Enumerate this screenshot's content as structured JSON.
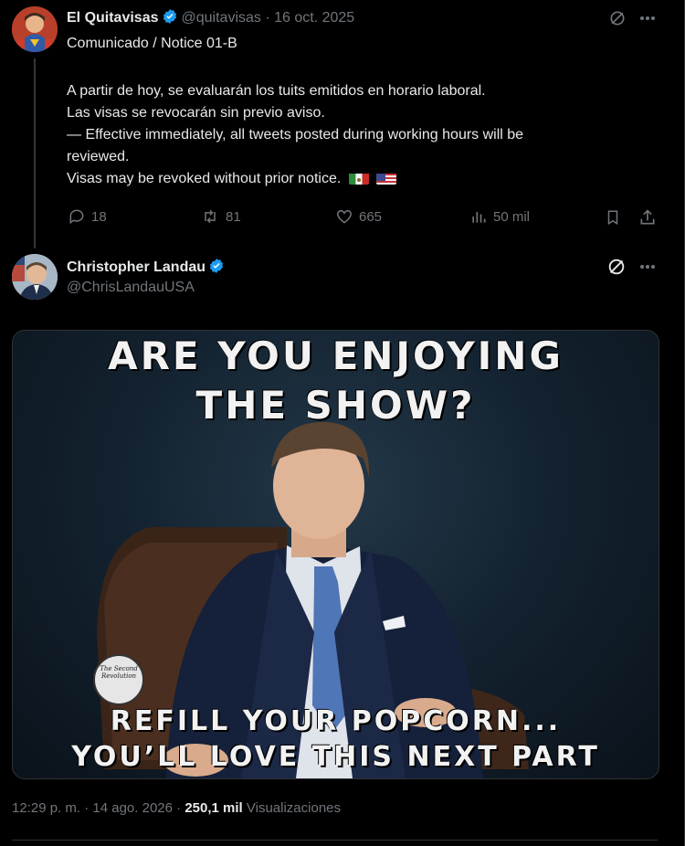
{
  "colors": {
    "background": "#000000",
    "text": "#e7e9ea",
    "muted": "#71767b",
    "verified": "#1d9bf0",
    "border": "#2f3336"
  },
  "parent_tweet": {
    "author_name": "El Quitavisas",
    "handle": "@quitavisas",
    "separator": "·",
    "date": "16 oct. 2025",
    "lines": [
      "Comunicado / Notice 01-B",
      "A partir de hoy, se evaluarán los tuits emitidos en horario laboral.",
      "Las visas se revocarán sin previo aviso.",
      "— Effective immediately, all tweets posted during working hours will be",
      "reviewed.",
      "Visas may be revoked without prior notice."
    ],
    "flags": [
      "mexico-flag",
      "usa-flag"
    ],
    "replies": "18",
    "reposts": "81",
    "likes": "665",
    "views": "50 mil",
    "icons": [
      "reply-icon",
      "repost-icon",
      "like-icon",
      "views-icon",
      "bookmark-icon",
      "share-icon",
      "grok-icon",
      "more-icon"
    ]
  },
  "main_tweet": {
    "author_name": "Christopher Landau",
    "handle": "@ChrisLandauUSA",
    "image": {
      "top_line1": "ARE YOU ENJOYING",
      "top_line2": "THE SHOW?",
      "bottom_line1": "REFILL YOUR POPCORN...",
      "bottom_line2": "YOU’LL LOVE THIS NEXT PART",
      "watermark": "The Second Revolution"
    },
    "time": "12:29 p. m.",
    "dot": "·",
    "date": "14 ago. 2026",
    "views_count": "250,1 mil",
    "views_label": "Visualizaciones"
  }
}
